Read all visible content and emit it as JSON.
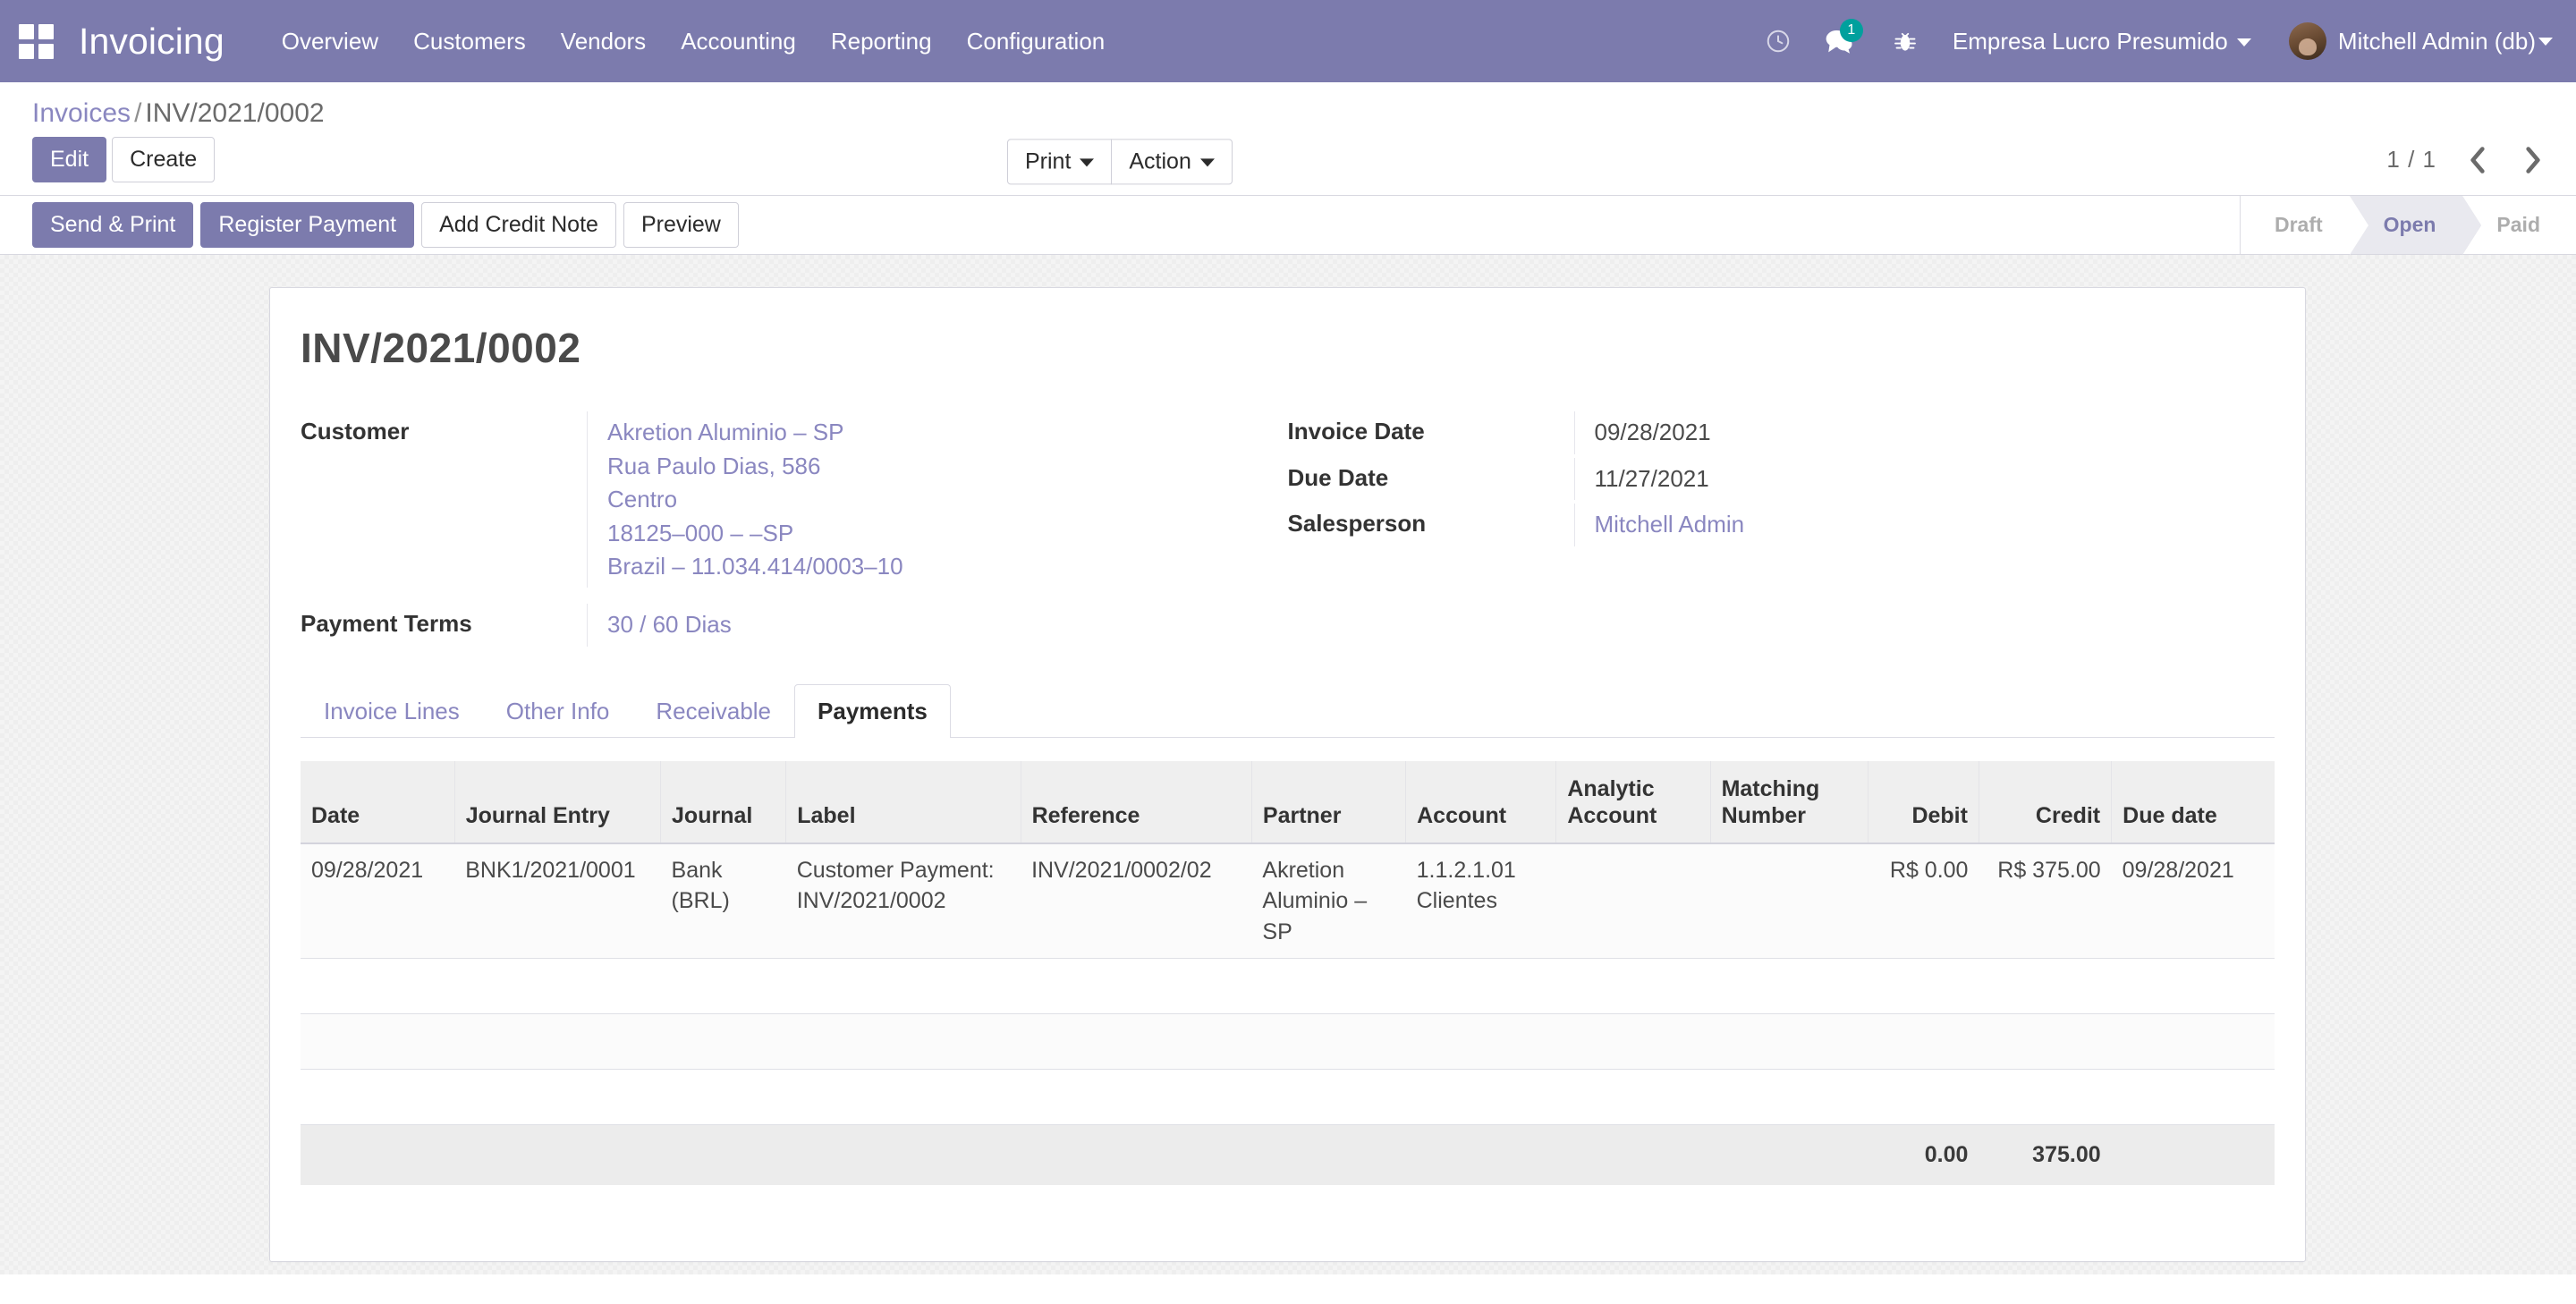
{
  "navbar": {
    "apps_icon": "apps-grid-icon",
    "brand": "Invoicing",
    "menu": [
      {
        "label": "Overview"
      },
      {
        "label": "Customers"
      },
      {
        "label": "Vendors"
      },
      {
        "label": "Accounting"
      },
      {
        "label": "Reporting"
      },
      {
        "label": "Configuration"
      }
    ],
    "activity_icon": "clock-activity-icon",
    "messages_icon": "chat-bubble-icon",
    "messages_badge": "1",
    "debug_icon": "bug-icon",
    "company": "Empresa Lucro Presumido",
    "user": "Mitchell Admin (db)",
    "avatar": "user-avatar",
    "accent": "#7c7bad",
    "badge_color": "#00a09d"
  },
  "control_panel": {
    "breadcrumb_root": "Invoices",
    "breadcrumb_sep": "/",
    "breadcrumb_current": "INV/2021/0002",
    "edit_label": "Edit",
    "create_label": "Create",
    "print_label": "Print",
    "action_label": "Action",
    "pager_value": "1 / 1",
    "prev_icon": "chevron-left-icon",
    "next_icon": "chevron-right-icon"
  },
  "statusbar_row": {
    "buttons": [
      {
        "label": "Send & Print",
        "primary": true
      },
      {
        "label": "Register Payment",
        "primary": true
      },
      {
        "label": "Add Credit Note",
        "primary": false
      },
      {
        "label": "Preview",
        "primary": false
      }
    ],
    "states": [
      {
        "label": "Draft",
        "active": false
      },
      {
        "label": "Open",
        "active": true
      },
      {
        "label": "Paid",
        "active": false
      }
    ]
  },
  "sheet": {
    "title": "INV/2021/0002",
    "left_fields": [
      {
        "label": "Customer",
        "lines": [
          "Akretion Aluminio – SP",
          "Rua Paulo Dias, 586",
          "Centro",
          "18125–000 – –SP",
          "Brazil – 11.034.414/0003–10"
        ],
        "link": true
      },
      {
        "label": "Payment Terms",
        "lines": [
          "30 / 60 Dias"
        ],
        "link": true
      }
    ],
    "right_fields": [
      {
        "label": "Invoice Date",
        "value": "09/28/2021",
        "link": false
      },
      {
        "label": "Due Date",
        "value": "11/27/2021",
        "link": false
      },
      {
        "label": "Salesperson",
        "value": "Mitchell Admin",
        "link": true
      }
    ],
    "tabs": [
      {
        "label": "Invoice Lines",
        "active": false
      },
      {
        "label": "Other Info",
        "active": false
      },
      {
        "label": "Receivable",
        "active": false
      },
      {
        "label": "Payments",
        "active": true
      }
    ],
    "table": {
      "headers": [
        "Date",
        "Journal Entry",
        "Journal",
        "Label",
        "Reference",
        "Partner",
        "Account",
        "Analytic Account",
        "Matching Number",
        "Debit",
        "Credit",
        "Due date"
      ],
      "rows": [
        {
          "date": "09/28/2021",
          "journal_entry": "BNK1/2021/0001",
          "journal": "Bank (BRL)",
          "label": "Customer Payment: INV/2021/0002",
          "reference": "INV/2021/0002/02",
          "partner": "Akretion Aluminio – SP",
          "account": "1.1.2.1.01 Clientes",
          "analytic_account": "",
          "matching_number": "",
          "debit": "R$ 0.00",
          "credit": "R$ 375.00",
          "due_date": "09/28/2021"
        }
      ],
      "totals": {
        "debit": "0.00",
        "credit": "375.00"
      }
    }
  }
}
